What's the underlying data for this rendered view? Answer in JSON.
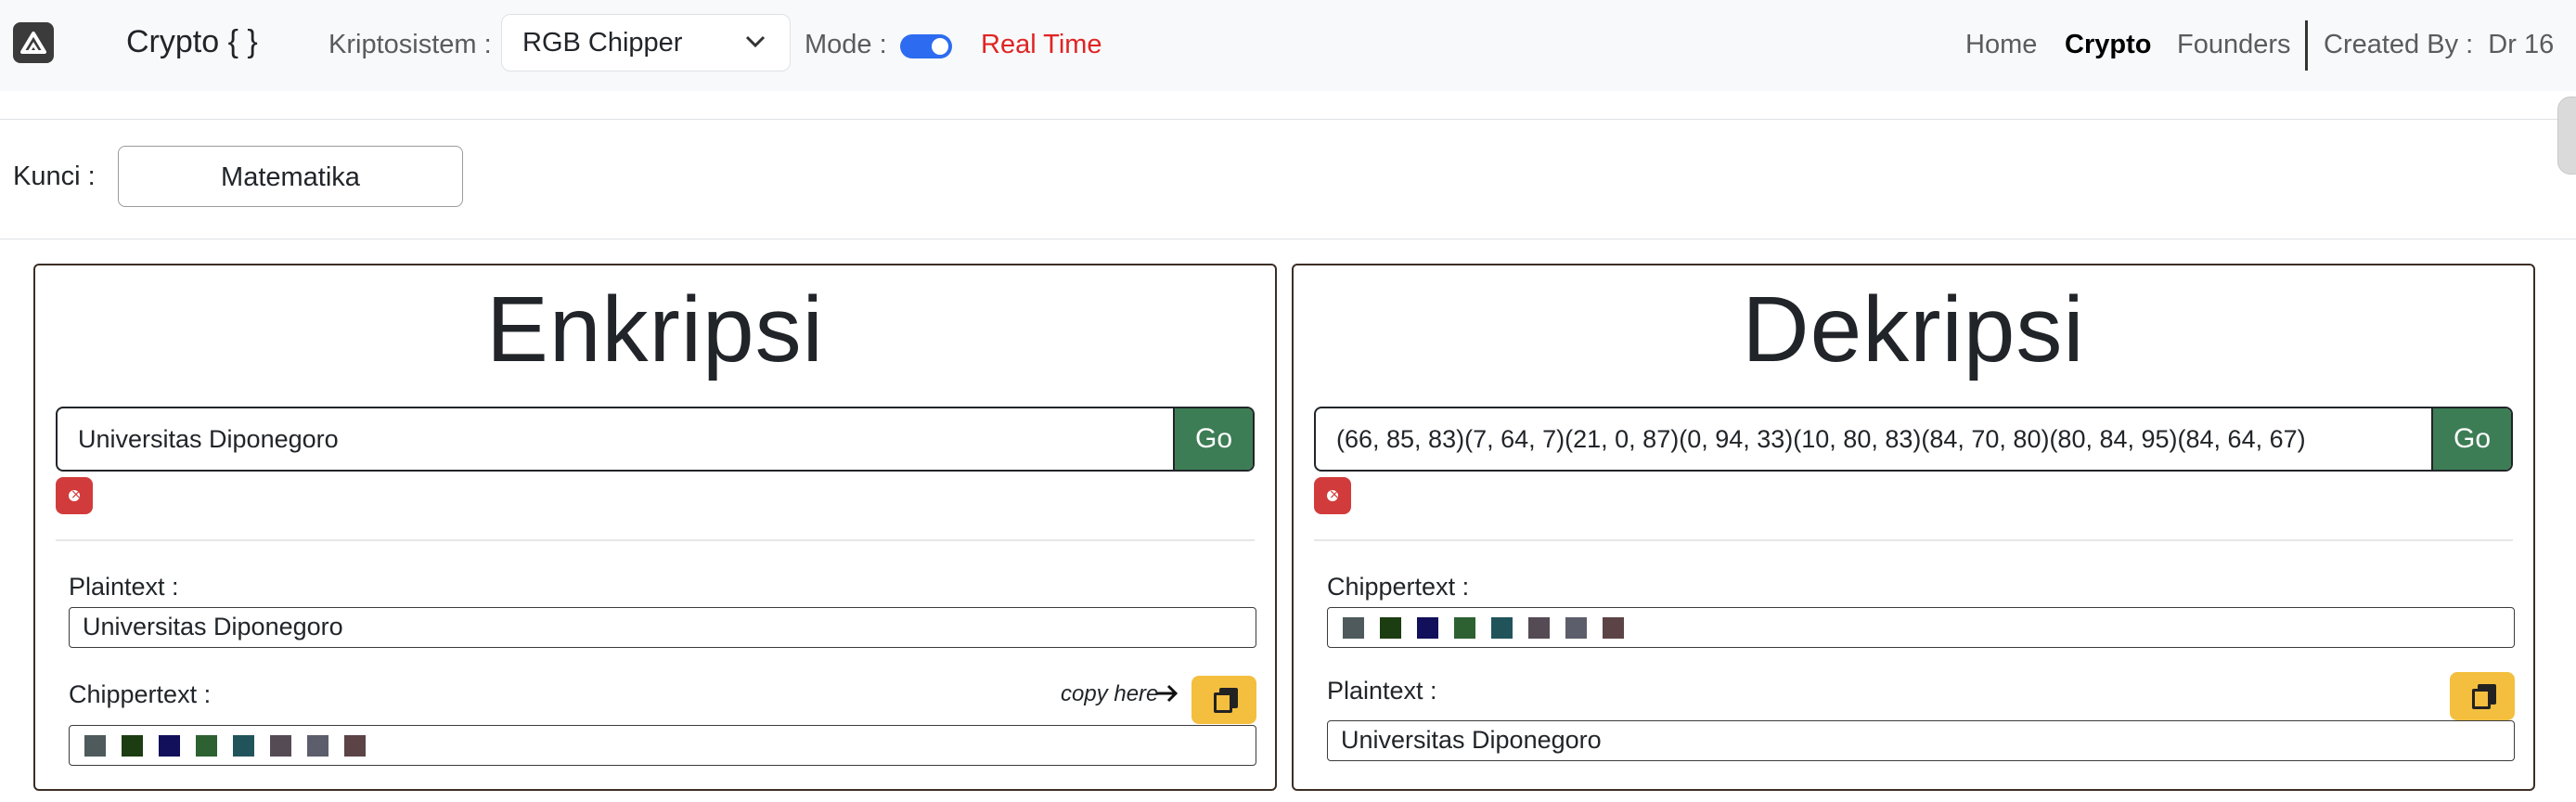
{
  "navbar": {
    "brand": "Crypto { }",
    "kripto_label": "Kriptosistem :",
    "selected_cipher": "RGB Chipper",
    "mode_label": "Mode :",
    "mode_value": "Real Time",
    "mode_on": true,
    "links": [
      "Home",
      "Crypto",
      "Founders"
    ],
    "active_link": "Crypto",
    "created_by": "Created By :  Dr 16"
  },
  "key": {
    "label": "Kunci :",
    "value": "Matematika"
  },
  "encrypt": {
    "title": "Enkripsi",
    "input": "Universitas Diponegoro",
    "go_label": "Go",
    "plaintext_label": "Plaintext :",
    "plaintext_value": "Universitas Diponegoro",
    "chippertext_label": "Chippertext :",
    "copy_hint": "copy here",
    "swatches": [
      "#4e5a5c",
      "#1c3d12",
      "#12105a",
      "#2d6131",
      "#21545a",
      "#554b55",
      "#5c5e6b",
      "#5c4346"
    ]
  },
  "decrypt": {
    "title": "Dekripsi",
    "input": "(66, 85, 83)(7, 64, 7)(21, 0, 87)(0, 94, 33)(10, 80, 83)(84, 70, 80)(80, 84, 95)(84, 64, 67)",
    "go_label": "Go",
    "chippertext_label": "Chippertext :",
    "plaintext_label": "Plaintext :",
    "plaintext_value": "Universitas Diponegoro",
    "swatches": [
      "#4e5a5c",
      "#1c3d12",
      "#12105a",
      "#2d6131",
      "#21545a",
      "#554b55",
      "#5c5e6b",
      "#5c4346"
    ]
  },
  "colors": {
    "go": "#3d7d55",
    "clear": "#d23b3b",
    "copy": "#f4bf3e",
    "accent": "#2d6cf0",
    "realtime": "#e02424"
  }
}
